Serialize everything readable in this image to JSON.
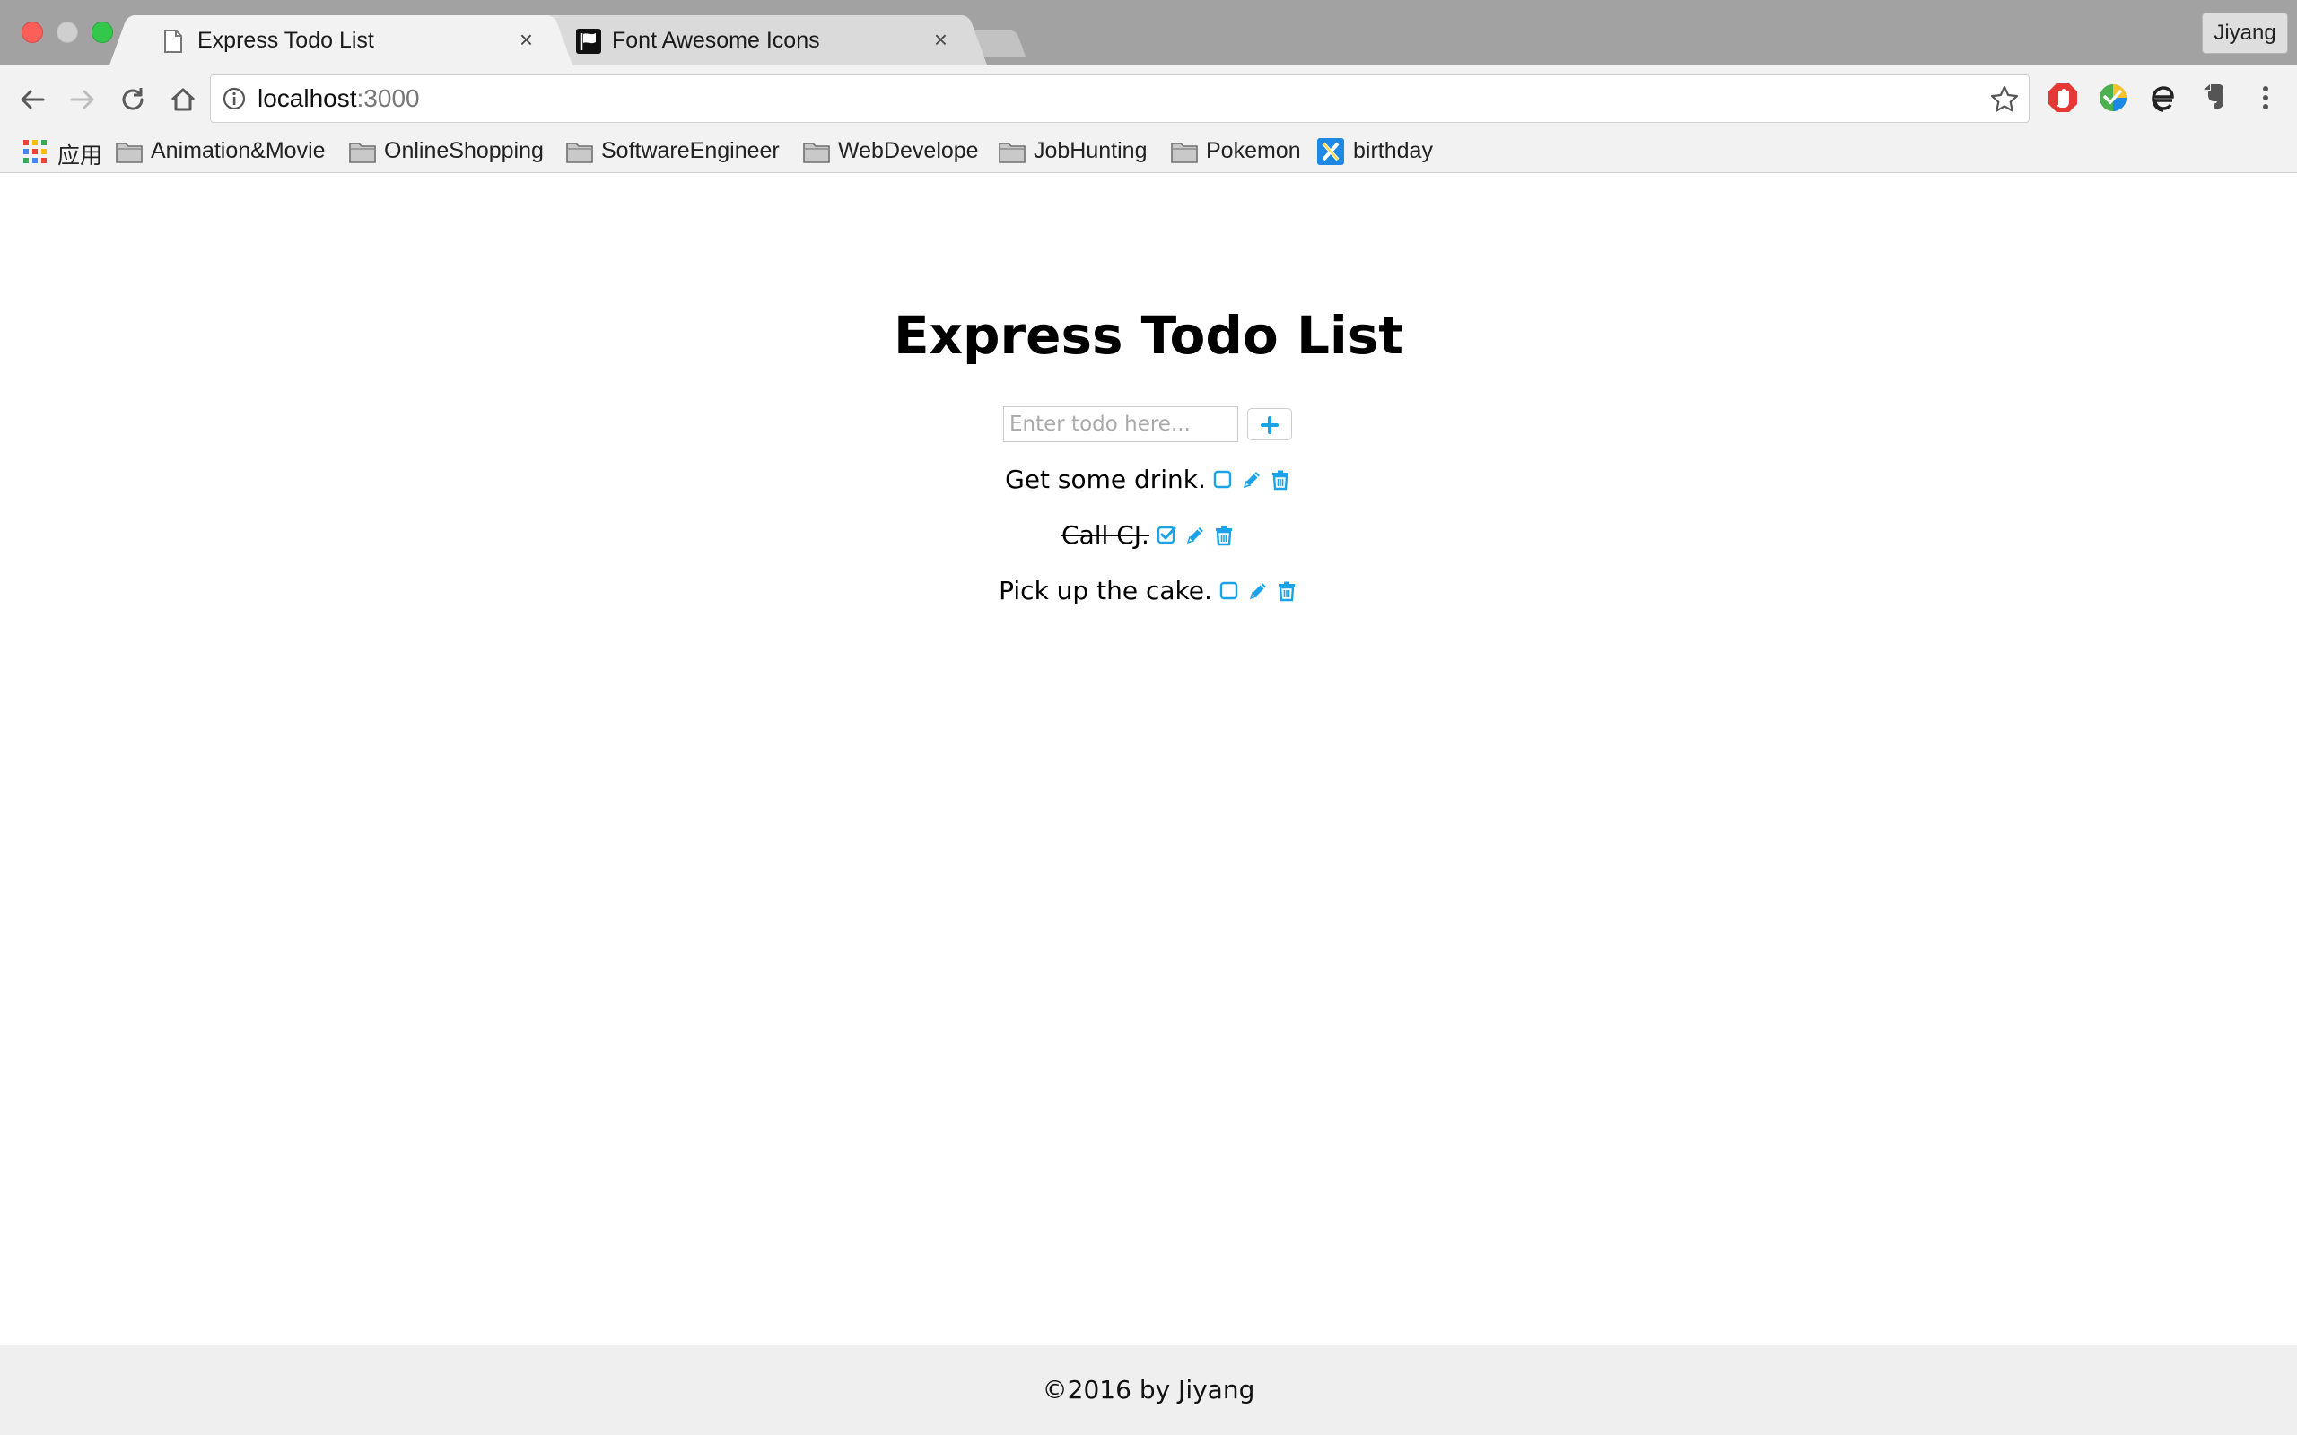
{
  "browser": {
    "tabs": [
      {
        "title": "Express Todo List",
        "active": true,
        "icon": "page-icon"
      },
      {
        "title": "Font Awesome Icons",
        "active": false,
        "icon": "flag-icon"
      }
    ],
    "profile_name": "Jiyang",
    "address": {
      "host": "localhost",
      "port": ":3000"
    },
    "bookmarks": [
      {
        "label": "应用",
        "icon": "apps-grid-icon"
      },
      {
        "label": "Animation&Movie",
        "icon": "folder-icon"
      },
      {
        "label": "OnlineShopping",
        "icon": "folder-icon"
      },
      {
        "label": "SoftwareEngineer",
        "icon": "folder-icon"
      },
      {
        "label": "WebDevelope",
        "icon": "folder-icon"
      },
      {
        "label": "JobHunting",
        "icon": "folder-icon"
      },
      {
        "label": "Pokemon",
        "icon": "folder-icon"
      },
      {
        "label": "birthday",
        "icon": "xmind-icon"
      }
    ],
    "tab_close_glyph": "×"
  },
  "page": {
    "title": "Express Todo List",
    "input_placeholder": "Enter todo here...",
    "todos": [
      {
        "text": "Get some drink.",
        "done": false
      },
      {
        "text": "Call CJ.",
        "done": true
      },
      {
        "text": "Pick up the cake.",
        "done": false
      }
    ],
    "footer": "©2016 by Jiyang",
    "accent_color": "#1aa3e8"
  }
}
